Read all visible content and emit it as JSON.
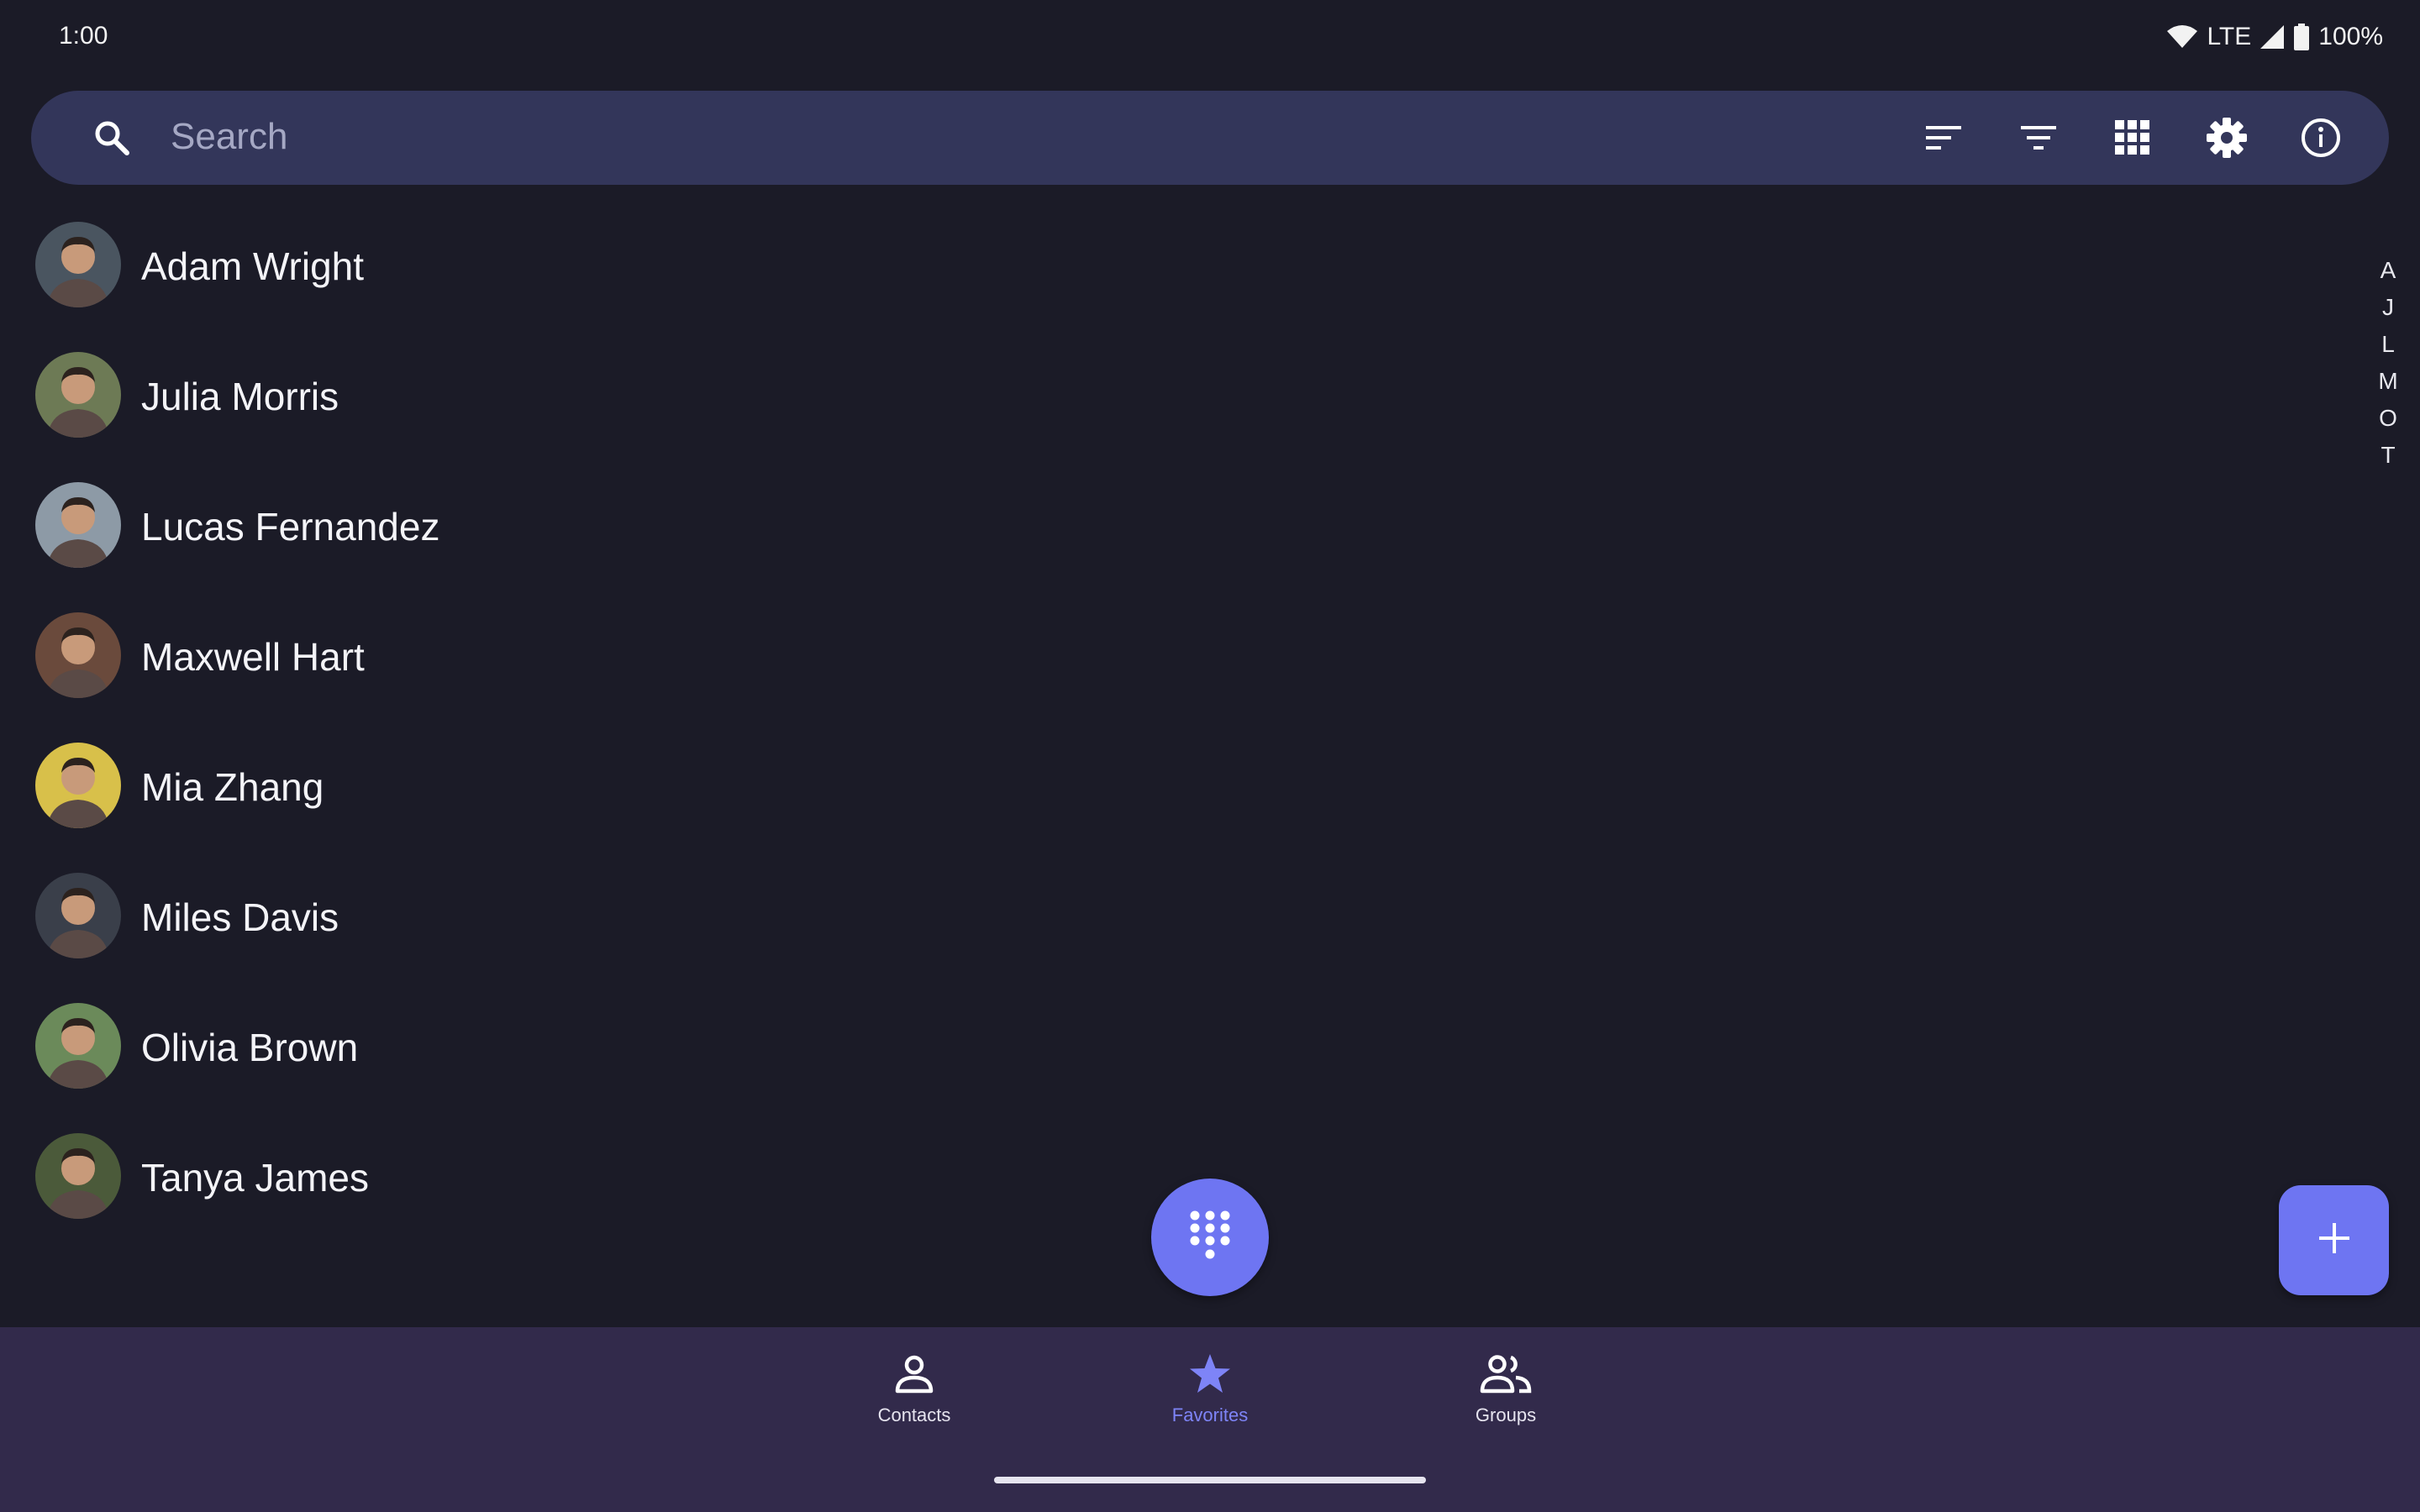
{
  "status_bar": {
    "time": "1:00",
    "network": "LTE",
    "battery": "100%",
    "icons": [
      "wifi-icon",
      "signal-icon",
      "battery-icon"
    ]
  },
  "search": {
    "placeholder": "Search",
    "icon": "search-icon"
  },
  "toolbar": {
    "buttons": [
      "sort-icon",
      "filter-icon",
      "grid-icon",
      "settings-icon",
      "info-icon"
    ]
  },
  "contacts": [
    {
      "name": "Adam Wright",
      "avatar_bg": "#4a5560"
    },
    {
      "name": "Julia Morris",
      "avatar_bg": "#6d7a55"
    },
    {
      "name": "Lucas Fernandez",
      "avatar_bg": "#8d9aa6"
    },
    {
      "name": "Maxwell Hart",
      "avatar_bg": "#6a4a3c"
    },
    {
      "name": "Mia Zhang",
      "avatar_bg": "#d8c04a"
    },
    {
      "name": "Miles Davis",
      "avatar_bg": "#3a3f4a"
    },
    {
      "name": "Olivia Brown",
      "avatar_bg": "#6b8a5a"
    },
    {
      "name": "Tanya James",
      "avatar_bg": "#4b5a3a"
    }
  ],
  "alphabet_index": [
    "A",
    "J",
    "L",
    "M",
    "O",
    "T"
  ],
  "fabs": {
    "dialpad": "dialpad-icon",
    "add": "plus-icon"
  },
  "bottom_nav": [
    {
      "label": "Contacts",
      "icon": "person-icon",
      "active": false
    },
    {
      "label": "Favorites",
      "icon": "star-icon",
      "active": true
    },
    {
      "label": "Groups",
      "icon": "group-icon",
      "active": false
    }
  ],
  "colors": {
    "background": "#1b1b27",
    "search_bar": "#33365a",
    "accent": "#6e75f2",
    "bottom_nav": "#322a4b"
  }
}
